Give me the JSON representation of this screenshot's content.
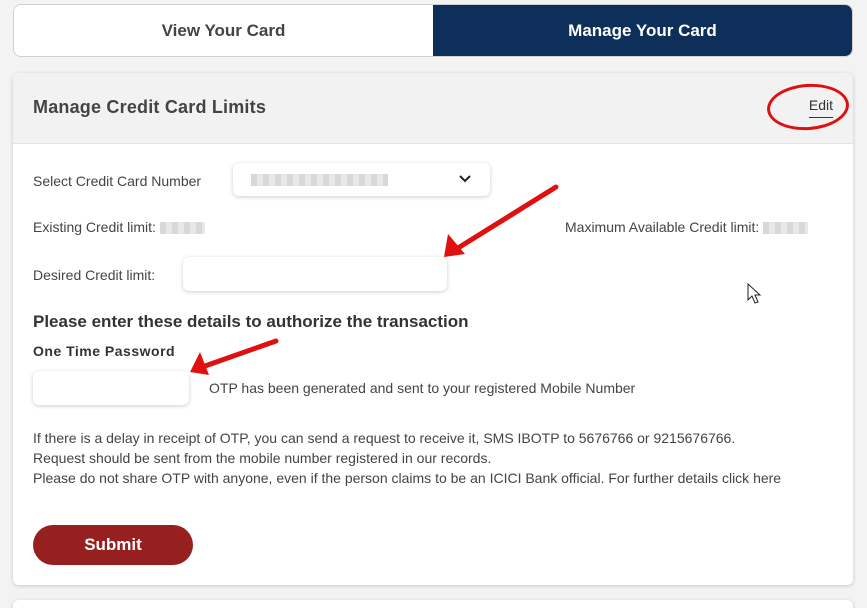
{
  "tabs": [
    {
      "label": "View Your Card",
      "active": false
    },
    {
      "label": "Manage Your Card",
      "active": true
    }
  ],
  "card": {
    "title": "Manage Credit Card Limits",
    "edit_label": "Edit"
  },
  "form": {
    "card_number_label": "Select Credit Card Number",
    "card_number_value": "",
    "existing_limit_label": "Existing Credit limit:",
    "existing_limit_value": "",
    "max_limit_label": "Maximum Available Credit limit:",
    "max_limit_value": "",
    "desired_limit_label": "Desired Credit limit:",
    "desired_limit_value": "",
    "auth_title": "Please enter these details to authorize the transaction",
    "otp_label": "One Time Password",
    "otp_value": "",
    "otp_status": "OTP has been generated and sent to your registered Mobile Number",
    "info_line1": "If there is a delay in receipt of OTP, you can send a request to receive it, SMS IBOTP to 5676766 or 9215676766.",
    "info_line2": "Request should be sent from the mobile number registered in our records.",
    "info_line3": "Please do not share OTP with anyone, even if the person claims to be an ICICI Bank official. For further details click here",
    "submit_label": "Submit"
  },
  "colors": {
    "active_tab": "#0e2f5a",
    "submit": "#96201f",
    "annotation": "#e01010"
  }
}
